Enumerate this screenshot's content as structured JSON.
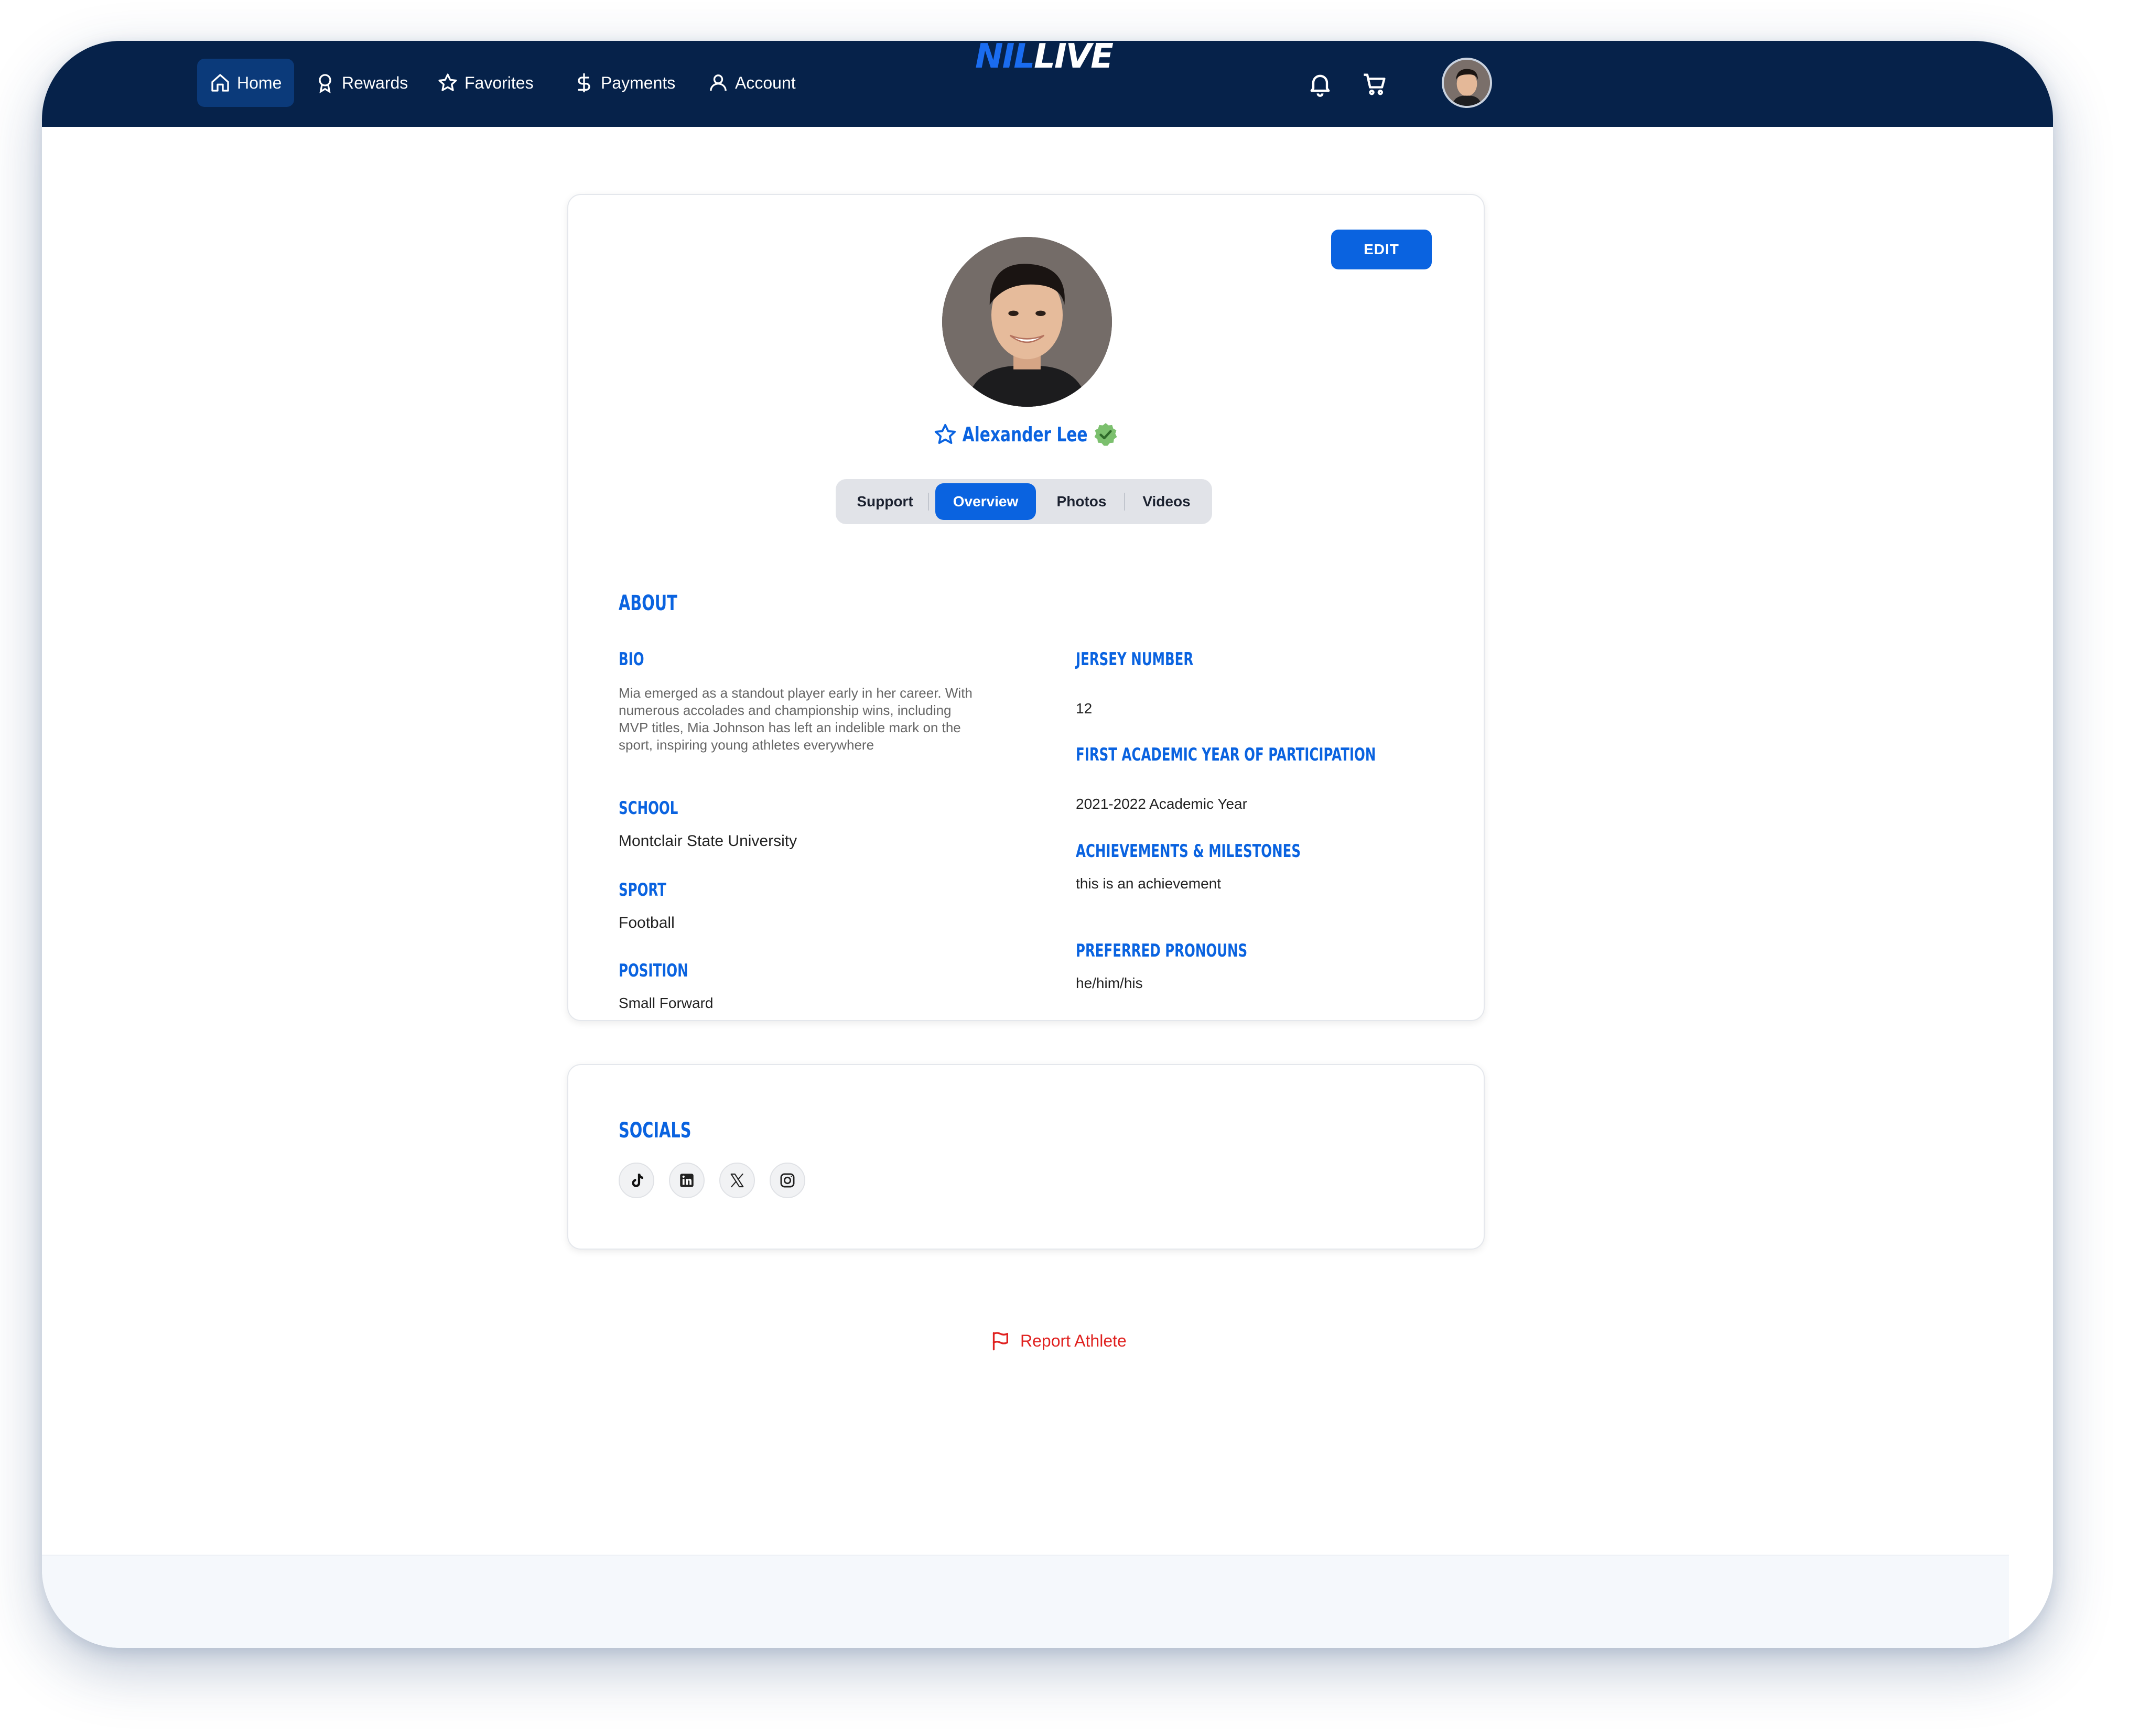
{
  "nav": {
    "items": [
      {
        "label": "Home",
        "icon": "home-icon",
        "active": true
      },
      {
        "label": "Rewards",
        "icon": "award-icon"
      },
      {
        "label": "Favorites",
        "icon": "star-icon"
      },
      {
        "label": "Payments",
        "icon": "dollar-icon"
      },
      {
        "label": "Account",
        "icon": "user-icon"
      }
    ],
    "logo_nil": "NIL",
    "logo_live": "LIVE",
    "actions": [
      "bell-icon",
      "cart-icon"
    ],
    "bg_color": "#06224a"
  },
  "profile": {
    "edit_label": "EDIT",
    "name": "Alexander Lee",
    "verified": true,
    "accent": "#0a63e0",
    "tabs": [
      "Support",
      "Overview",
      "Photos",
      "Videos"
    ],
    "active_tab": "Overview"
  },
  "about": {
    "heading": "ABOUT",
    "bio_label": "BIO",
    "bio_text": "Mia emerged as a standout player early in her career. With numerous accolades and championship wins, including MVP titles, Mia Johnson has left an indelible mark on the sport, inspiring young athletes everywhere",
    "school_label": "SCHOOL",
    "school": "Montclair State University",
    "sport_label": "SPORT",
    "sport": "Football",
    "position_label": "POSITION",
    "position": "Small Forward",
    "jersey_label": "JERSEY NUMBER",
    "jersey": "12",
    "first_year_label": "FIRST ACADEMIC YEAR OF PARTICIPATION",
    "first_year": "2021-2022 Academic Year",
    "achievements_label": "ACHIEVEMENTS & MILESTONES",
    "achievements": "this is an achievement",
    "pronouns_label": "PREFERRED PRONOUNS",
    "pronouns": "he/him/his"
  },
  "socials": {
    "heading": "SOCIALS",
    "items": [
      "tiktok-icon",
      "linkedin-icon",
      "x-icon",
      "instagram-icon"
    ]
  },
  "report": {
    "label": "Report Athlete",
    "color": "#e0211f"
  }
}
